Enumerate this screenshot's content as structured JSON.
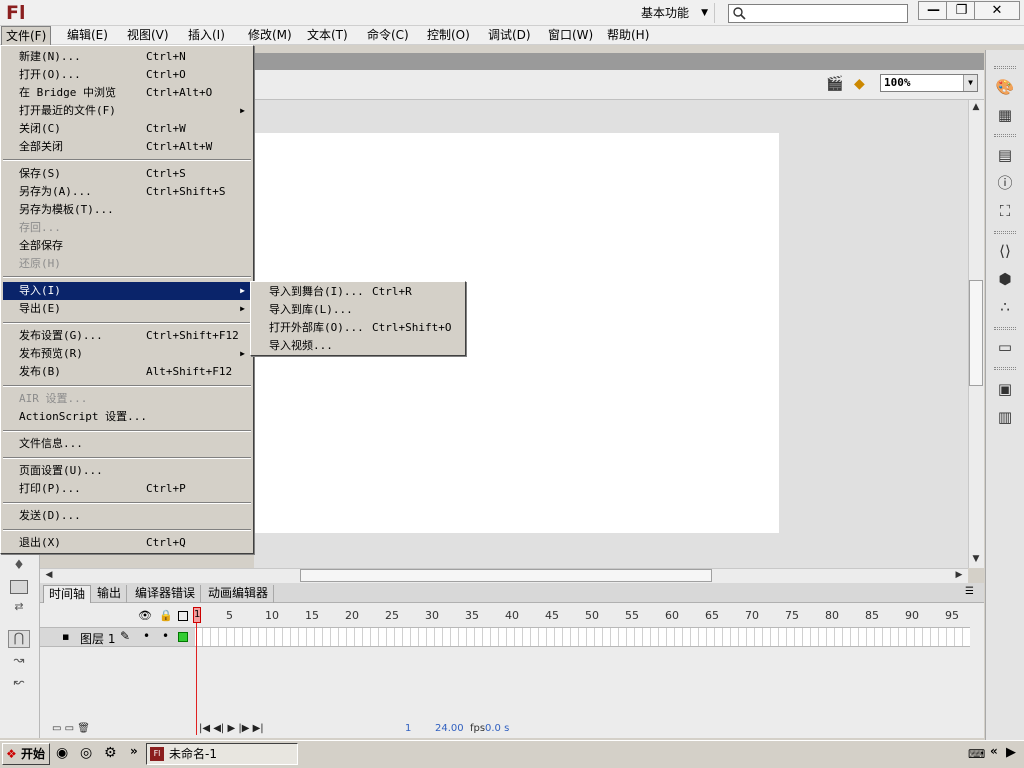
{
  "app": {
    "logo": "Fl",
    "workspace": "基本功能",
    "search_placeholder": ""
  },
  "window_controls": {
    "minimize": "—",
    "restore": "❐",
    "close": "✕"
  },
  "menubar": [
    "文件(F)",
    "编辑(E)",
    "视图(V)",
    "插入(I)",
    "修改(M)",
    "文本(T)",
    "命令(C)",
    "控制(O)",
    "调试(D)",
    "窗口(W)",
    "帮助(H)"
  ],
  "file_menu": [
    {
      "label": "新建(N)...",
      "shortcut": "Ctrl+N"
    },
    {
      "label": "打开(O)...",
      "shortcut": "Ctrl+O"
    },
    {
      "label": "在 Bridge 中浏览",
      "shortcut": "Ctrl+Alt+O"
    },
    {
      "label": "打开最近的文件(F)",
      "shortcut": ""
    },
    {
      "label": "关闭(C)",
      "shortcut": "Ctrl+W"
    },
    {
      "label": "全部关闭",
      "shortcut": "Ctrl+Alt+W"
    },
    {
      "label": "保存(S)",
      "shortcut": "Ctrl+S"
    },
    {
      "label": "另存为(A)...",
      "shortcut": "Ctrl+Shift+S"
    },
    {
      "label": "另存为模板(T)...",
      "shortcut": ""
    },
    {
      "label": "存回...",
      "shortcut": ""
    },
    {
      "label": "全部保存",
      "shortcut": ""
    },
    {
      "label": "还原(H)",
      "shortcut": ""
    },
    {
      "label": "导入(I)",
      "shortcut": ""
    },
    {
      "label": "导出(E)",
      "shortcut": ""
    },
    {
      "label": "发布设置(G)...",
      "shortcut": "Ctrl+Shift+F12"
    },
    {
      "label": "发布预览(R)",
      "shortcut": ""
    },
    {
      "label": "发布(B)",
      "shortcut": "Alt+Shift+F12"
    },
    {
      "label": "AIR 设置...",
      "shortcut": ""
    },
    {
      "label": "ActionScript 设置...",
      "shortcut": ""
    },
    {
      "label": "文件信息...",
      "shortcut": ""
    },
    {
      "label": "页面设置(U)...",
      "shortcut": ""
    },
    {
      "label": "打印(P)...",
      "shortcut": "Ctrl+P"
    },
    {
      "label": "发送(D)...",
      "shortcut": ""
    },
    {
      "label": "退出(X)",
      "shortcut": "Ctrl+Q"
    }
  ],
  "import_submenu": [
    {
      "label": "导入到舞台(I)...",
      "shortcut": "Ctrl+R"
    },
    {
      "label": "导入到库(L)...",
      "shortcut": ""
    },
    {
      "label": "打开外部库(O)...",
      "shortcut": "Ctrl+Shift+O"
    },
    {
      "label": "导入视频...",
      "shortcut": ""
    }
  ],
  "zoom": "100%",
  "timeline": {
    "tabs": [
      "时间轴",
      "输出",
      "编译器错误",
      "动画编辑器"
    ],
    "layer_name": "图层 1",
    "frame_numbers": [
      "1",
      "5",
      "10",
      "15",
      "20",
      "25",
      "30",
      "35",
      "40",
      "45",
      "50",
      "55",
      "60",
      "65",
      "70",
      "75",
      "80",
      "85",
      "90",
      "95"
    ],
    "current_frame": "1",
    "fps": "24.00",
    "fps_unit": "fps",
    "time": "0.0 s"
  },
  "taskbar": {
    "start": "开始",
    "task_item": "未命名-1",
    "chevron": "»"
  },
  "glyphs": {
    "submenu_arrow": "▶",
    "dropdown": "▼",
    "visible_dot": "•"
  }
}
